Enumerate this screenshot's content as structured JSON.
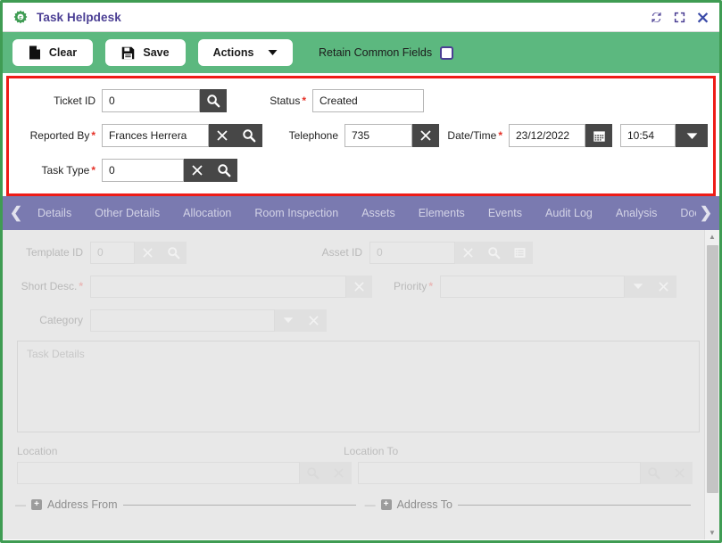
{
  "window": {
    "title": "Task Helpdesk",
    "app_icon": "gear-icon",
    "accent_green": "#5cb87f",
    "accent_purple": "#7a7ab0",
    "highlight_red": "#ee1c17",
    "buttons": [
      {
        "name": "refresh-icon",
        "label": "Refresh"
      },
      {
        "name": "maximize-icon",
        "label": "Maximize"
      },
      {
        "name": "close-icon",
        "label": "Close"
      }
    ]
  },
  "toolbar": {
    "clear_label": "Clear",
    "save_label": "Save",
    "actions_label": "Actions",
    "retain_label": "Retain Common Fields",
    "retain_checked": false
  },
  "form": {
    "ticket_id": {
      "label": "Ticket ID",
      "value": "0",
      "required": false
    },
    "status": {
      "label": "Status",
      "value": "Created",
      "required": true
    },
    "reported_by": {
      "label": "Reported By",
      "value": "Frances Herrera",
      "required": true
    },
    "telephone": {
      "label": "Telephone",
      "value": "735",
      "required": false
    },
    "date_time": {
      "label": "Date/Time",
      "date": "23/12/2022",
      "time": "10:54",
      "required": true
    },
    "task_type": {
      "label": "Task Type",
      "value": "0",
      "required": true
    }
  },
  "tabs": {
    "prev_arrow": "❮",
    "next_arrow": "❯",
    "items": [
      {
        "label": "Details"
      },
      {
        "label": "Other Details"
      },
      {
        "label": "Allocation"
      },
      {
        "label": "Room Inspection"
      },
      {
        "label": "Assets"
      },
      {
        "label": "Elements"
      },
      {
        "label": "Events"
      },
      {
        "label": "Audit Log"
      },
      {
        "label": "Analysis"
      },
      {
        "label": "Docur"
      }
    ]
  },
  "details": {
    "template_id": {
      "label": "Template ID",
      "value": "0"
    },
    "asset_id": {
      "label": "Asset ID",
      "value": "0"
    },
    "short_desc": {
      "label": "Short Desc.",
      "value": "",
      "required": true
    },
    "priority": {
      "label": "Priority",
      "value": "",
      "required": true
    },
    "category": {
      "label": "Category",
      "value": ""
    },
    "task_details": {
      "label": "Task Details",
      "value": ""
    },
    "location": {
      "label": "Location",
      "value": ""
    },
    "location_to": {
      "label": "Location To",
      "value": ""
    },
    "address_from": {
      "label": "Address From"
    },
    "address_to": {
      "label": "Address To"
    }
  }
}
